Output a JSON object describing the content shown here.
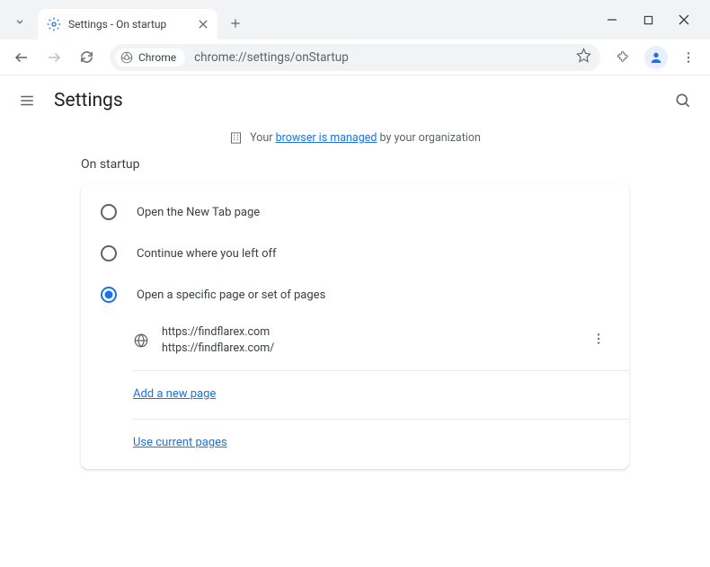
{
  "window": {
    "tab_title": "Settings - On startup"
  },
  "toolbar": {
    "chrome_chip": "Chrome",
    "url": "chrome://settings/onStartup"
  },
  "header": {
    "title": "Settings"
  },
  "managed": {
    "prefix": "Your ",
    "link": "browser is managed",
    "suffix": " by your organization"
  },
  "section": {
    "title": "On startup"
  },
  "options": {
    "new_tab": "Open the New Tab page",
    "continue": "Continue where you left off",
    "specific": "Open a specific page or set of pages"
  },
  "startup_page": {
    "title": "https://findflarex.com",
    "url": "https://findflarex.com/"
  },
  "links": {
    "add": "Add a new page",
    "current": "Use current pages"
  }
}
